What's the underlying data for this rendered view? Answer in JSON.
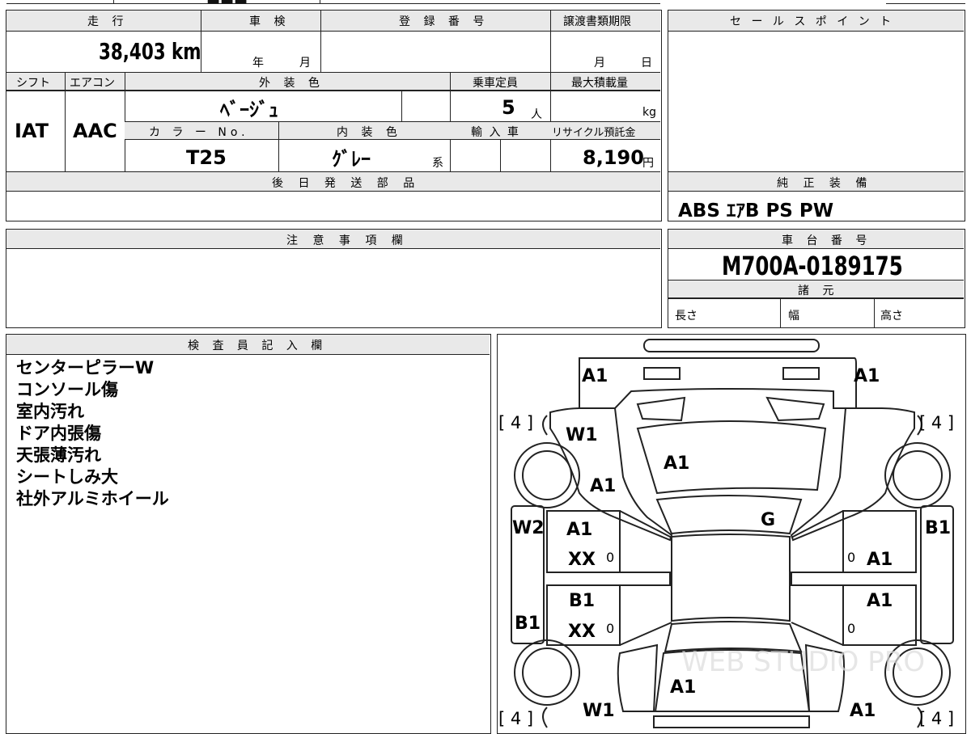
{
  "top_strip": {
    "fragment": "■■■"
  },
  "mileage": {
    "label": "走 行",
    "value": "38,403",
    "unit": "km"
  },
  "inspection": {
    "label": "車 検",
    "year_unit": "年",
    "month_unit": "月"
  },
  "registration": {
    "label": "登 録 番 号"
  },
  "transfer_deadline": {
    "label": "譲渡書類期限",
    "month_unit": "月",
    "day_unit": "日"
  },
  "sale_points": {
    "label": "セ ー ル ス ポ イ ン ト"
  },
  "shift": {
    "label": "シフト",
    "value": "IAT"
  },
  "aircon": {
    "label": "エアコン",
    "value": "AAC"
  },
  "exterior_color": {
    "label": "外 装 色",
    "value": "ﾍﾞｰｼﾞｭ"
  },
  "capacity": {
    "label": "乗車定員",
    "value": "5",
    "unit": "人"
  },
  "max_load": {
    "label": "最大積載量",
    "unit": "kg"
  },
  "color_no": {
    "label": "カ ラ ー No.",
    "value": "T25"
  },
  "interior_color": {
    "label": "内 装 色",
    "value": "ｸﾞﾚｰ",
    "suffix": "系"
  },
  "import": {
    "label": "輸 入 車"
  },
  "recycle": {
    "label": "リサイクル預託金",
    "value": "8,190",
    "unit": "円"
  },
  "later_parts": {
    "label": "後 日 発 送 部 品"
  },
  "equipment": {
    "label": "純 正 装 備",
    "value": "ABS ｴｱB PS PW"
  },
  "notes": {
    "label": "注 意 事 項 欄"
  },
  "chassis": {
    "label": "車 台 番 号",
    "value": "M700A-0189175"
  },
  "specs": {
    "label": "諸 元",
    "length": "長さ",
    "width": "幅",
    "height": "高さ"
  },
  "inspector": {
    "label": "検 査 員 記 入 欄",
    "comments": [
      "センターピラーW",
      "コンソール傷",
      "室内汚れ",
      "ドア内張傷",
      "天張薄汚れ",
      "シートしみ大",
      "社外アルミホイール"
    ]
  },
  "diagram": {
    "tire_tl": "[ 4 ]",
    "tire_tr": "[ 4 ]",
    "tire_bl": "[ 4 ]",
    "tire_br": "[ 4 ]",
    "front_left_a1": "A1",
    "front_right_a1": "A1",
    "left_fender_w1": "W1",
    "left_fender_a1": "A1",
    "hood_a1": "A1",
    "windshield_g": "G",
    "left_pillar_w2": "W2",
    "right_side_b1": "B1",
    "front_door_left_a1": "A1",
    "front_door_left_xx": "XX",
    "front_door_left_zero": "0",
    "front_door_right_zero": "0",
    "front_door_right_a1": "A1",
    "rear_door_left_b1": "B1",
    "rear_door_left_xx": "XX",
    "rear_door_left_zero": "0",
    "left_sill_b1": "B1",
    "rear_door_right_a1": "A1",
    "rear_door_right_zero": "0",
    "trunk_a1": "A1",
    "rear_left_w1": "W1",
    "rear_right_a1": "A1",
    "watermark": "WEB STUDIO PRO"
  }
}
